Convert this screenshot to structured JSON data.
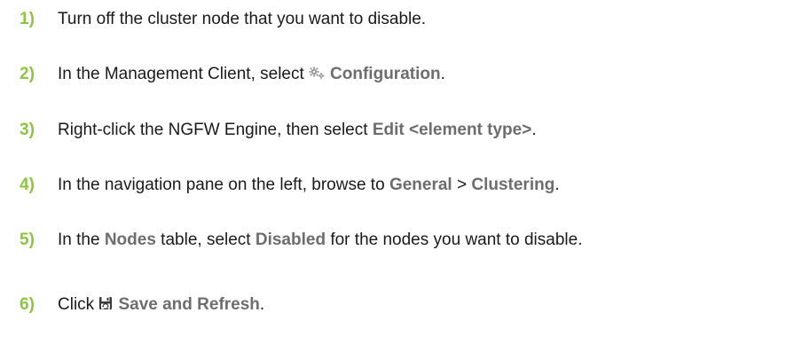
{
  "steps": [
    {
      "number": "1)",
      "parts": [
        "Turn off the cluster node that you want to disable."
      ]
    },
    {
      "number": "2)",
      "parts": [
        "In the Management Client, select ",
        "Configuration",
        "."
      ]
    },
    {
      "number": "3)",
      "parts": [
        "Right-click the NGFW Engine, then select ",
        "Edit <element type>",
        "."
      ]
    },
    {
      "number": "4)",
      "parts": [
        "In the navigation pane on the left, browse to ",
        "General",
        " > ",
        "Clustering",
        "."
      ]
    },
    {
      "number": "5)",
      "parts": [
        "In the ",
        "Nodes",
        " table, select ",
        "Disabled",
        " for the nodes you want to disable."
      ]
    },
    {
      "number": "6)",
      "parts": [
        "Click ",
        "Save and Refresh",
        "."
      ]
    }
  ],
  "icons": {
    "configuration": "gears-icon",
    "save": "save-refresh-icon"
  },
  "colors": {
    "step_number": "#8cc63f",
    "ui_label": "#6d6d6d",
    "body_text": "#1a1a1a"
  }
}
